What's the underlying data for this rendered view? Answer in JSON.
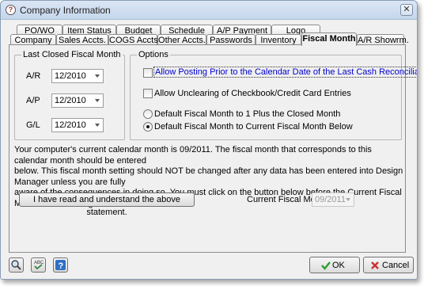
{
  "window": {
    "title": "Company Information"
  },
  "tabs_back": [
    "PO/WO",
    "Item Status",
    "Budget",
    "Schedule",
    "A/P Payment",
    "Logo"
  ],
  "tabs_front": [
    "Company",
    "Sales Accts.",
    "COGS Accts.",
    "Other Accts.",
    "Passwords",
    "Inventory",
    "Fiscal Month",
    "A/R Showrm."
  ],
  "active_tab": "Fiscal Month",
  "last_closed": {
    "group_label": "Last Closed Fiscal Month",
    "rows": [
      {
        "label": "A/R",
        "value": "12/2010"
      },
      {
        "label": "A/P",
        "value": "12/2010"
      },
      {
        "label": "G/L",
        "value": "12/2010"
      }
    ]
  },
  "options": {
    "group_label": "Options",
    "checkboxes": [
      {
        "label": "Allow Posting Prior to the Calendar Date of the Last Cash Reconciliation",
        "checked": false,
        "focused": true
      },
      {
        "label": "Allow Unclearing of Checkbook/Credit Card Entries",
        "checked": false,
        "focused": false
      }
    ],
    "radios": [
      {
        "label": "Default Fiscal Month to 1 Plus the Closed Month",
        "selected": false
      },
      {
        "label": "Default Fiscal Month to Current Fiscal Month Below",
        "selected": true
      }
    ]
  },
  "notice": {
    "line1": "Your computer's current calendar month is 09/2011.  The fiscal month that corresponds to this calendar month should be entered",
    "line2": "below.  This fiscal month setting should NOT be changed after any data has been entered into Design Manager unless you are fully",
    "line3": "aware of the consequences in doing so.  You must click on the button below before the Current Fiscal Month can be changed."
  },
  "acknowledge_button": "I have read and understand the above statement.",
  "current_fiscal": {
    "label": "Current Fiscal Month",
    "value": "09/2011"
  },
  "footer": {
    "ok_label": "OK",
    "cancel_label": "Cancel",
    "icons": [
      "search-icon",
      "spellcheck-icon",
      "help-icon"
    ]
  },
  "colors": {
    "focused_text": "#0000cc",
    "ok_check": "#2e9e2e",
    "cancel_x": "#c8322f"
  }
}
